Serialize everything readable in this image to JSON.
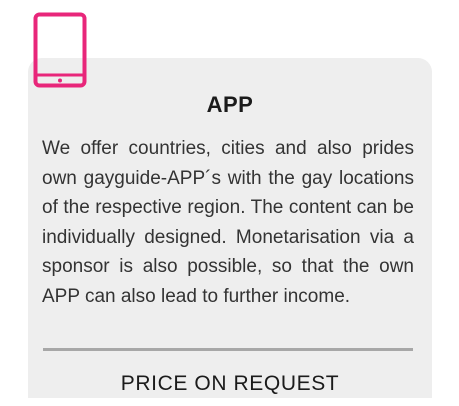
{
  "card": {
    "icon": "smartphone-icon",
    "accent_color": "#e8267a",
    "title": "APP",
    "description": "We offer countries, cities and also prides own gayguide-APP´s with the gay locations of the respective region. The content can be individually designed. Monetarisation via a sponsor is also possible, so that the own APP can also lead to further income.",
    "price_label": "PRICE ON REQUEST"
  }
}
